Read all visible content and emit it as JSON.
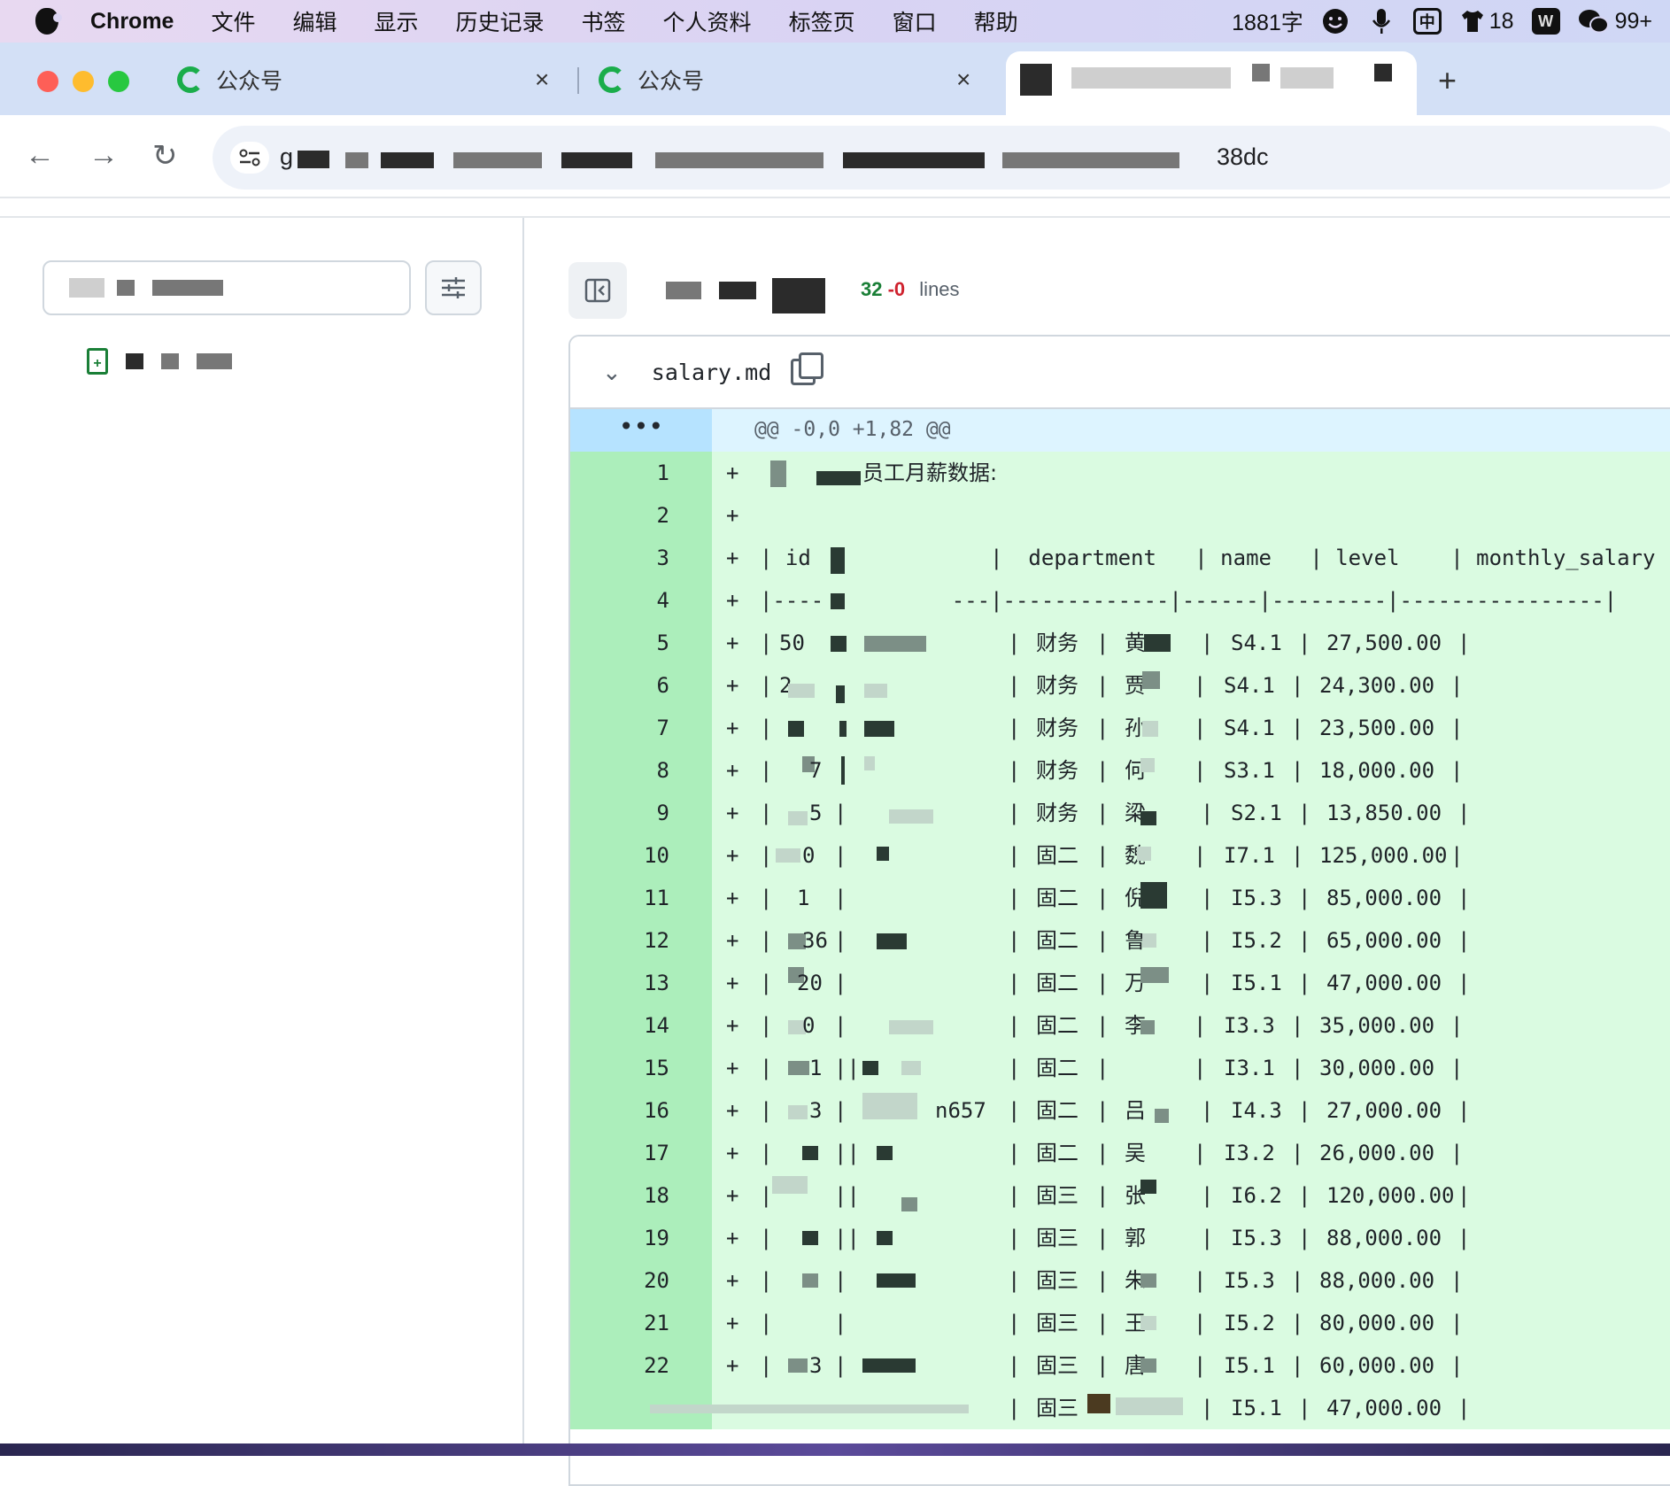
{
  "menubar": {
    "items": [
      "Chrome",
      "文件",
      "编辑",
      "显示",
      "历史记录",
      "书签",
      "个人资料",
      "标签页",
      "窗口",
      "帮助"
    ],
    "word_count": "1881字",
    "ime_label": "中",
    "notif_count": "18",
    "wechat_count": "99+"
  },
  "tabs": [
    {
      "title": "公众号",
      "close": "×"
    },
    {
      "title": "公众号",
      "close": "×"
    }
  ],
  "new_tab": "+",
  "address": {
    "prefix": "g",
    "suffix": "38dc"
  },
  "diff": {
    "stats_add": "32",
    "stats_del": "-0",
    "stats_lines": "lines",
    "file_name": "salary.md",
    "hunk": "@@ -0,0 +1,82 @@",
    "hunk_expand": "•••",
    "line1_text": "员工月薪数据:",
    "header_row": "| id              |  department   | name   | level    | monthly_salary |",
    "sep_row": "|----          ---|-------------|------|---------|----------------|",
    "rows": [
      {
        "ln": "5",
        "id": "50",
        "dept": "财务",
        "name": "黄",
        "level": "S4.1",
        "salary": "27,500.00"
      },
      {
        "ln": "6",
        "id": "2",
        "dept": "财务",
        "name": "贾",
        "level": "S4.1",
        "salary": "24,300.00"
      },
      {
        "ln": "7",
        "id": "",
        "dept": "财务",
        "name": "孙",
        "level": "S4.1",
        "salary": "23,500.00"
      },
      {
        "ln": "8",
        "id": "7",
        "dept": "财务",
        "name": "何",
        "level": "S3.1",
        "salary": "18,000.00"
      },
      {
        "ln": "9",
        "id": "5",
        "dept": "财务",
        "name": "梁",
        "level": "S2.1",
        "salary": "13,850.00"
      },
      {
        "ln": "10",
        "id": "0",
        "dept": "固二",
        "name": "魏",
        "level": "I7.1",
        "salary": "125,000.00"
      },
      {
        "ln": "11",
        "id": "1",
        "dept": "固二",
        "name": "倪",
        "level": "I5.3",
        "salary": "85,000.00"
      },
      {
        "ln": "12",
        "id": "36",
        "dept": "固二",
        "name": "鲁",
        "level": "I5.2",
        "salary": "65,000.00"
      },
      {
        "ln": "13",
        "id": "20",
        "dept": "固二",
        "name": "万",
        "level": "I5.1",
        "salary": "47,000.00"
      },
      {
        "ln": "14",
        "id": "0",
        "dept": "固二",
        "name": "李",
        "level": "I3.3",
        "salary": "35,000.00"
      },
      {
        "ln": "15",
        "id": "1",
        "dept": "固二",
        "name": "",
        "level": "I3.1",
        "salary": "30,000.00"
      },
      {
        "ln": "16",
        "id": "3",
        "dept": "固二",
        "name": "吕",
        "level": "I4.3",
        "salary": "27,000.00",
        "extra": "n657"
      },
      {
        "ln": "17",
        "id": "",
        "dept": "固二",
        "name": "吴",
        "level": "I3.2",
        "salary": "26,000.00"
      },
      {
        "ln": "18",
        "id": "",
        "dept": "固三",
        "name": "张",
        "level": "I6.2",
        "salary": "120,000.00"
      },
      {
        "ln": "19",
        "id": "",
        "dept": "固三",
        "name": "郭",
        "level": "I5.3",
        "salary": "88,000.00"
      },
      {
        "ln": "20",
        "id": "",
        "dept": "固三",
        "name": "朱",
        "level": "I5.3",
        "salary": "88,000.00"
      },
      {
        "ln": "21",
        "id": "",
        "dept": "固三",
        "name": "王",
        "level": "I5.2",
        "salary": "80,000.00"
      },
      {
        "ln": "22",
        "id": "3",
        "dept": "固三",
        "name": "唐",
        "level": "I5.1",
        "salary": "60,000.00"
      },
      {
        "ln": "",
        "id": "",
        "dept": "固三",
        "name": "",
        "level": "I5.1",
        "salary": "47,000.00"
      }
    ]
  }
}
